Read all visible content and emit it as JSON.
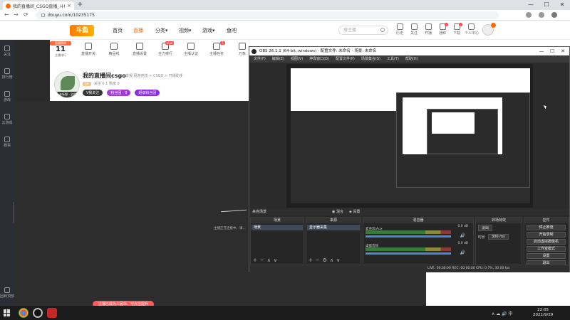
{
  "browser": {
    "tab_title": "我的直播间_CSGO直播_斗鱼直播",
    "tab_close": "×",
    "new_tab": "+",
    "win_min": "—",
    "win_max": "☐",
    "win_close": "✕",
    "url": "douyu.com/10235175",
    "nav_back": "←",
    "nav_forward": "→",
    "nav_reload": "⟳"
  },
  "site": {
    "logo": "斗鱼",
    "nav": [
      "首页",
      "直播",
      "分类▾",
      "视频▾",
      "游戏▾",
      "鱼吧"
    ],
    "search_placeholder": "搜主播",
    "header_icons": [
      "历史",
      "关注",
      "开播",
      "通知",
      "下载",
      "个人中心"
    ]
  },
  "sidebar": {
    "items": [
      "关注",
      "排行榜",
      "游戏",
      "云游戏",
      "赛事",
      "回到顶部"
    ]
  },
  "room": {
    "rank_badge": "直播榜单",
    "rank_num": "11",
    "rank_label": "主播排行",
    "tools": [
      "直播开关",
      "精品线",
      "直播设置",
      "主力排行",
      "主播认证",
      "主播任务",
      "万象"
    ],
    "tool_tags": [
      "",
      "",
      "",
      "new",
      "",
      "1",
      ""
    ],
    "avatar_label": "未标题 · 全部",
    "title": "我的直播间csgo",
    "meta": "举报  网游竞技 > CSGO > 开播助手",
    "lv": "Lv",
    "line2": "关注 0  1  热度 0",
    "pills": [
      "V我关注",
      "粉丝团 · 0",
      "超级粉丝团"
    ]
  },
  "obs": {
    "title": "OBS 26.1.1 (64-bit, windows) - 配置文件: 未命名 - 场景: 未命名",
    "win_min": "—",
    "win_max": "☐",
    "win_close": "✕",
    "menu": [
      "文件(F)",
      "编辑(E)",
      "视图(V)",
      "停靠窗口(D)",
      "配置文件(P)",
      "场景集合(S)",
      "工具(T)",
      "帮助(H)"
    ],
    "current_scene_label": "来自场景",
    "scene_buttons": [
      "◉ 混合",
      "◈ 设置"
    ],
    "docks": {
      "scenes": {
        "header": "场景",
        "selected": "场景",
        "foot": [
          "+",
          "−",
          "∧",
          "∨"
        ]
      },
      "sources": {
        "header": "来源",
        "selected": "显示器采集",
        "foot": [
          "+",
          "−",
          "⚙",
          "∧",
          "∨"
        ]
      },
      "mixer": {
        "header": "混音器",
        "rows": [
          {
            "name": "麦克风/Aux",
            "db": "0.0 dB",
            "speaker": "🔊"
          },
          {
            "name": "桌面音频",
            "db": "0.0 dB",
            "speaker": "🔊"
          }
        ]
      },
      "transitions": {
        "header": "转场特效",
        "type_label": "淡出",
        "duration_label": "时长",
        "duration_value": "300 ms"
      },
      "controls": {
        "header": "控件",
        "buttons": [
          "停止推流",
          "开始录制",
          "启动虚拟摄像机",
          "工作室模式",
          "设置",
          "退出"
        ]
      }
    },
    "status": "LIVE: 00:00:00   REC: 00:00:00   CPU: 0.7%, 30.00 fps"
  },
  "side_note": "主播正在连接中，请...",
  "toast": "主播已成为人民币，可点击提升",
  "taskbar": {
    "time": "22:05",
    "date": "2021/9/29",
    "tray": "∧  ☁  🔊  中"
  },
  "colors": {
    "accent": "#ff6a00",
    "obs_bg": "#2b2b2b",
    "taskbar": "#1c1c1c"
  }
}
